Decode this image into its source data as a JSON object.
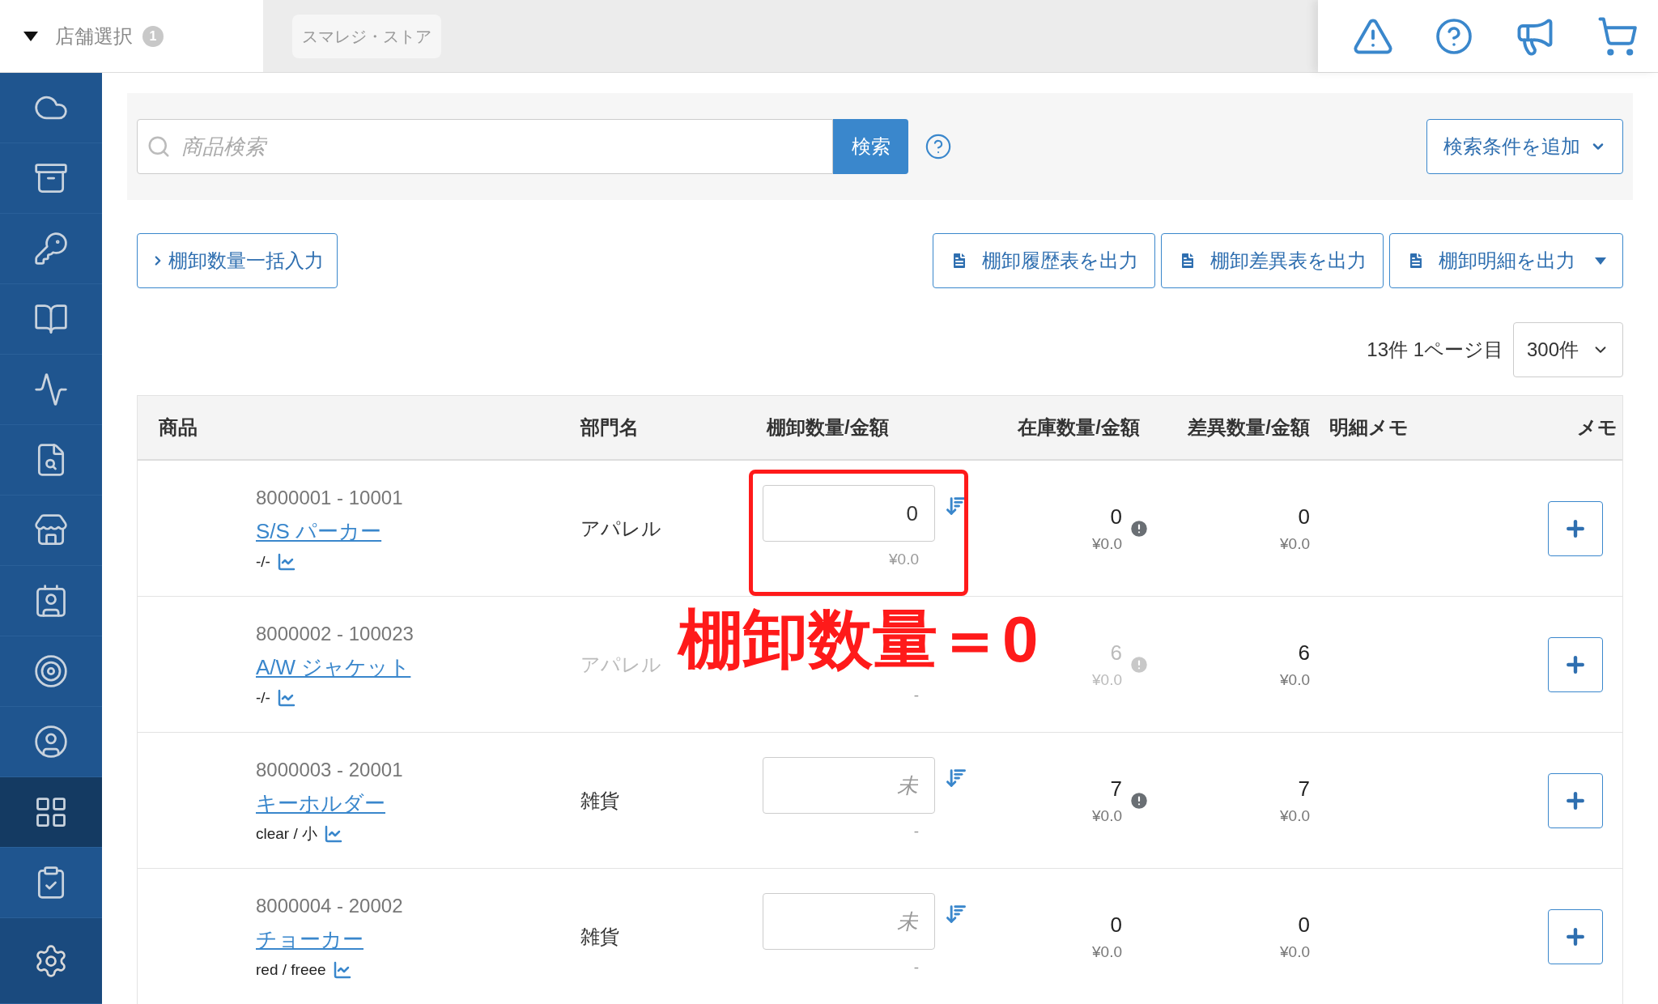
{
  "store_selector": {
    "label": "店舗選択",
    "badge": "1"
  },
  "store_chip": "スマレジ・ストア",
  "sidebar": {
    "items": [
      {
        "selected": false
      },
      {
        "selected": false
      },
      {
        "selected": false
      },
      {
        "selected": false
      },
      {
        "selected": false
      },
      {
        "selected": false
      },
      {
        "selected": false
      },
      {
        "selected": false
      },
      {
        "selected": false
      },
      {
        "selected": false
      },
      {
        "selected": true
      },
      {
        "selected": false
      },
      {
        "selected": false
      }
    ]
  },
  "search": {
    "placeholder": "商品検索",
    "button": "検索",
    "add_condition": "検索条件を追加"
  },
  "bulk_button": "棚卸数量一括入力",
  "export_buttons": [
    {
      "label": "棚卸履歴表を出力",
      "dropdown": false
    },
    {
      "label": "棚卸差異表を出力",
      "dropdown": false
    },
    {
      "label": "棚卸明細を出力",
      "dropdown": true
    }
  ],
  "pagination": {
    "summary": "13件 1ページ目",
    "per_page": "300件"
  },
  "table": {
    "columns": [
      "商品",
      "部門名",
      "棚卸数量/金額",
      "在庫数量/金額",
      "差異数量/金額",
      "明細メモ",
      "メモ"
    ],
    "rows": [
      {
        "code": "8000001 - 10001",
        "name": "S/S パーカー",
        "variant": "-/-",
        "department": "アパレル",
        "disabled": false,
        "count": {
          "value": "0"
        },
        "count_amount": "¥0.0",
        "stock": "0",
        "stock_amount": "¥0.0",
        "stock_warning": true,
        "diff": "0",
        "diff_amount": "¥0.0"
      },
      {
        "code": "8000002 - 100023",
        "name": "A/W ジャケット",
        "variant": "-/-",
        "department": "アパレル",
        "disabled": true,
        "count_amount": "-",
        "stock": "6",
        "stock_amount": "¥0.0",
        "stock_warning": true,
        "diff": "6",
        "diff_amount": "¥0.0"
      },
      {
        "code": "8000003 - 20001",
        "name": "キーホルダー",
        "variant": "clear / 小",
        "department": "雑貨",
        "disabled": false,
        "count": {
          "placeholder": "未"
        },
        "count_amount": "-",
        "stock": "7",
        "stock_amount": "¥0.0",
        "stock_warning": true,
        "diff": "7",
        "diff_amount": "¥0.0"
      },
      {
        "code": "8000004 - 20002",
        "name": "チョーカー",
        "variant": "red / freee",
        "department": "雑貨",
        "disabled": false,
        "count": {
          "placeholder": "未"
        },
        "count_amount": "-",
        "stock": "0",
        "stock_amount": "¥0.0",
        "stock_warning": false,
        "diff": "0",
        "diff_amount": "¥0.0"
      }
    ]
  },
  "annotation": {
    "text": "棚卸数量＝0"
  }
}
